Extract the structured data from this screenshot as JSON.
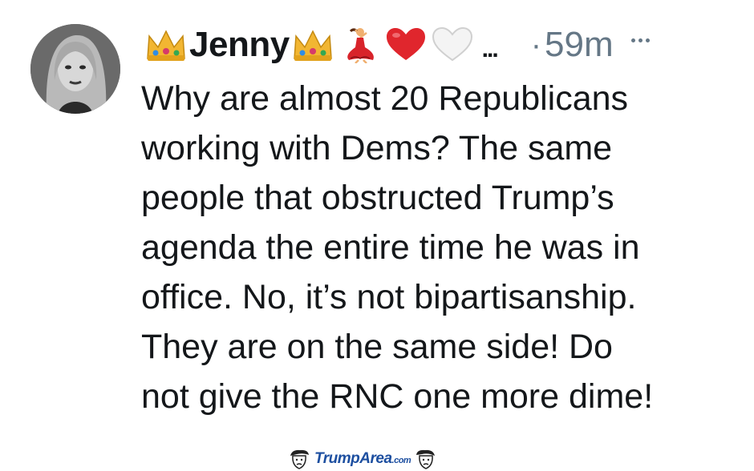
{
  "tweet": {
    "display_name": "Jenny",
    "name_emojis": [
      "crown-icon",
      "crown-icon",
      "dancer-icon",
      "red-heart-icon",
      "white-heart-icon"
    ],
    "name_overflow": "...",
    "separator": "·",
    "timestamp": "59m",
    "text_lines": [
      "Why are almost 20 Republicans",
      "working with Dems? The same",
      "people that obstructed Trump’s",
      "agenda the entire time he was in",
      "office. No, it’s not bipartisanship.",
      "They are on the same side! Do",
      "not give the RNC one more dime!"
    ]
  },
  "watermark": {
    "brand": "TrumpArea",
    "suffix": ".com"
  }
}
